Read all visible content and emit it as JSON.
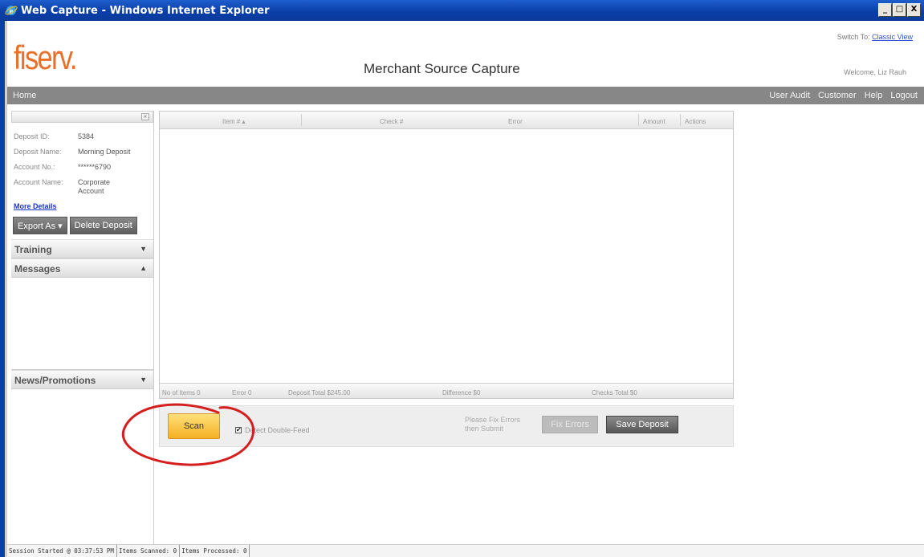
{
  "window": {
    "title": "Web Capture - Windows Internet Explorer",
    "buttons": [
      "_",
      "□",
      "X"
    ]
  },
  "header": {
    "logo_text": "fiserv.",
    "app_title": "Merchant Source Capture",
    "switch_label": "Switch To:",
    "switch_link": "Classic View",
    "welcome": "Welcome, Liz Rauh"
  },
  "nav": {
    "home": "Home",
    "right": [
      "User Audit",
      "Customer",
      "Help",
      "Logout"
    ]
  },
  "sidebar": {
    "collapse_icon": "«",
    "deposit_id_label": "Deposit ID:",
    "deposit_id": "5384",
    "deposit_name_label": "Deposit Name:",
    "deposit_name": "Morning Deposit",
    "account_no_label": "Account No.:",
    "account_no": "******6790",
    "account_name_label": "Account Name:",
    "account_name": "Corporate Account",
    "more_details": "More Details",
    "export_button": "Export As",
    "delete_button": "Delete Deposit",
    "panels": {
      "training": "Training",
      "messages": "Messages",
      "news": "News/Promotions"
    }
  },
  "grid": {
    "columns": {
      "item": "Item # ▴",
      "check": "Check #",
      "error": "Error",
      "amount": "Amount",
      "actions": "Actions"
    },
    "footer": {
      "items": "No of Items 0",
      "error": "Error 0",
      "deposit_total": "Deposit Total $245.00",
      "difference": "Difference $0",
      "checks_total": "Checks Total $0"
    }
  },
  "actions": {
    "scan": "Scan",
    "detect_double_feed": "Detect Double-Feed",
    "detect_checked": "✔",
    "fix_msg_line1": "Please Fix Errors",
    "fix_msg_line2": "then Submit",
    "fix_errors": "Fix Errors",
    "save_deposit": "Save Deposit"
  },
  "statusbar": {
    "session": "Session Started @ 03:37:53 PM",
    "items_scanned": "Items Scanned: 0",
    "items_processed": "Items Processed: 0"
  },
  "colors": {
    "titlebar": "#0a3fa8",
    "logo": "#e8702a",
    "navbar": "#878787",
    "scan_button": "#f5b024",
    "annotation": "#d41f1f"
  }
}
